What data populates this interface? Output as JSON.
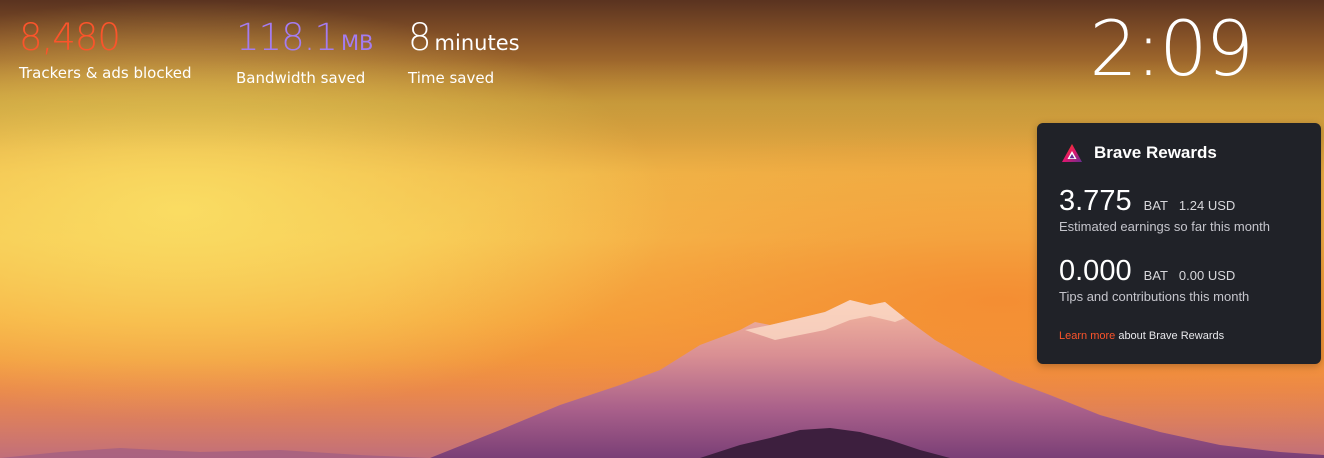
{
  "stats": {
    "trackers": {
      "value": "8,480",
      "label": "Trackers & ads blocked",
      "color": "#fb542b"
    },
    "bandwidth": {
      "value": "118.1",
      "unit": "MB",
      "label": "Bandwidth saved",
      "color": "#a47cf0"
    },
    "time": {
      "value": "8",
      "unit": "minutes",
      "label": "Time saved",
      "color": "#ffffff"
    }
  },
  "clock": {
    "time": "2:09"
  },
  "rewards": {
    "icon": "brave-rewards-bat-icon",
    "title": "Brave Rewards",
    "earnings": {
      "amount": "3.775",
      "currency": "BAT",
      "usd": "1.24 USD",
      "description": "Estimated earnings so far this month"
    },
    "tips": {
      "amount": "0.000",
      "currency": "BAT",
      "usd": "0.00 USD",
      "description": "Tips and contributions this month"
    },
    "footer": {
      "link": "Learn more",
      "text": " about Brave Rewards"
    },
    "colors": {
      "card": "#202228",
      "accent": "#fb542b"
    }
  },
  "background": {
    "description_icon": "mountain-sunset-background"
  }
}
